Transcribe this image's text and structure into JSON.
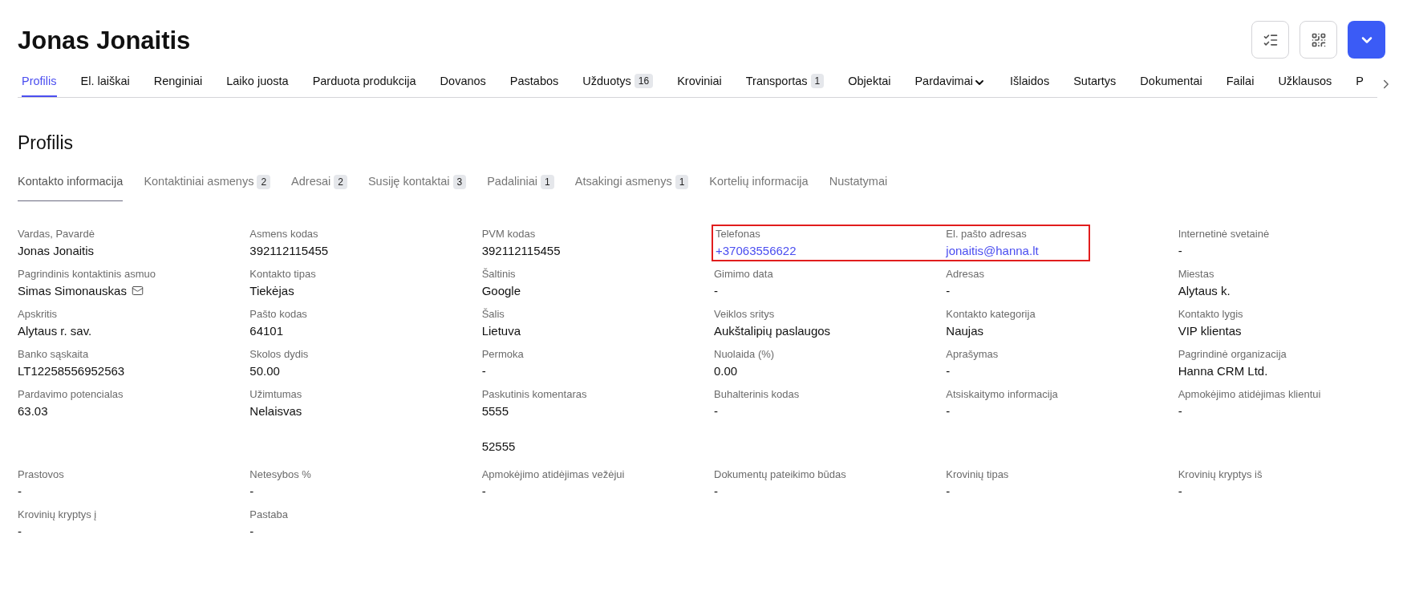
{
  "title": "Jonas Jonaitis",
  "header_buttons": [
    {
      "kind": "checklist"
    },
    {
      "kind": "qr"
    },
    {
      "kind": "dropdown"
    }
  ],
  "tabs": [
    {
      "label": "Profilis",
      "selected": true
    },
    {
      "label": "El. laiškai",
      "selected": false
    },
    {
      "label": "Renginiai",
      "selected": false
    },
    {
      "label": "Laiko juosta",
      "selected": false
    },
    {
      "label": "Parduota produkcija",
      "selected": false
    },
    {
      "label": "Dovanos",
      "selected": false
    },
    {
      "label": "Pastabos",
      "selected": false
    },
    {
      "label": "Užduotys",
      "badge": "16",
      "selected": false
    },
    {
      "label": "Kroviniai",
      "selected": false
    },
    {
      "label": "Transportas",
      "badge": "1",
      "selected": false
    },
    {
      "label": "Objektai",
      "selected": false
    },
    {
      "label": "Pardavimai",
      "dropdown": true,
      "selected": false
    },
    {
      "label": "Išlaidos",
      "selected": false
    },
    {
      "label": "Sutartys",
      "selected": false
    },
    {
      "label": "Dokumentai",
      "selected": false
    },
    {
      "label": "Failai",
      "selected": false
    },
    {
      "label": "Užklausos",
      "selected": false
    },
    {
      "label": "P",
      "selected": false
    }
  ],
  "section_title": "Profilis",
  "subtabs": [
    {
      "label": "Kontakto informacija",
      "selected": true
    },
    {
      "label": "Kontaktiniai asmenys",
      "badge": "2",
      "selected": false
    },
    {
      "label": "Adresai",
      "badge": "2",
      "selected": false
    },
    {
      "label": "Susiję kontaktai",
      "badge": "3",
      "selected": false
    },
    {
      "label": "Padaliniai",
      "badge": "1",
      "selected": false
    },
    {
      "label": "Atsakingi asmenys",
      "badge": "1",
      "selected": false
    },
    {
      "label": "Kortelių informacija",
      "selected": false
    },
    {
      "label": "Nustatymai",
      "selected": false
    }
  ],
  "field_groups": [
    [
      {
        "label": "Vardas, Pavardė",
        "value": "Jonas Jonaitis",
        "kind": "text",
        "highlighted": false
      },
      {
        "label": "Asmens kodas",
        "value": "392112115455",
        "kind": "text",
        "highlighted": false
      },
      {
        "label": "PVM kodas",
        "value": "392112115455",
        "kind": "text",
        "highlighted": false
      },
      {
        "label": "Telefonas",
        "value": "+37063556622",
        "kind": "link",
        "highlighted": true
      },
      {
        "label": "El. pašto adresas",
        "value": "jonaitis@hanna.lt",
        "kind": "link",
        "highlighted": true
      },
      {
        "label": "Internetinė svetainė",
        "value": "-",
        "kind": "text",
        "highlighted": false
      },
      {
        "label": "Pagrindinis kontaktinis asmuo",
        "value": "Simas Simonauskas",
        "kind": "contact",
        "highlighted": false
      },
      {
        "label": "Kontakto tipas",
        "value": "Tiekėjas",
        "kind": "text",
        "highlighted": false
      },
      {
        "label": "Šaltinis",
        "value": "Google",
        "kind": "text",
        "highlighted": false
      },
      {
        "label": "Gimimo data",
        "value": "-",
        "kind": "text",
        "highlighted": false
      },
      {
        "label": "Adresas",
        "value": "-",
        "kind": "text",
        "highlighted": false
      },
      {
        "label": "Miestas",
        "value": "Alytaus k.",
        "kind": "text",
        "highlighted": false
      },
      {
        "label": "Apskritis",
        "value": "Alytaus r. sav.",
        "kind": "text",
        "highlighted": false
      },
      {
        "label": "Pašto kodas",
        "value": "64101",
        "kind": "text",
        "highlighted": false
      },
      {
        "label": "Šalis",
        "value": "Lietuva",
        "kind": "text",
        "highlighted": false
      },
      {
        "label": "Veiklos sritys",
        "value": "Aukštalipių paslaugos",
        "kind": "text",
        "highlighted": false
      },
      {
        "label": "Kontakto kategorija",
        "value": "Naujas",
        "kind": "text",
        "highlighted": false
      },
      {
        "label": "Kontakto lygis",
        "value": "VIP klientas",
        "kind": "text",
        "highlighted": false
      },
      {
        "label": "Banko sąskaita",
        "value": "LT12258556952563",
        "kind": "text",
        "highlighted": false
      },
      {
        "label": "Skolos dydis",
        "value": "50.00",
        "kind": "text",
        "highlighted": false
      },
      {
        "label": "Permoka",
        "value": "-",
        "kind": "text",
        "highlighted": false
      },
      {
        "label": "Nuolaida (%)",
        "value": "0.00",
        "kind": "text",
        "highlighted": false
      },
      {
        "label": "Aprašymas",
        "value": "-",
        "kind": "text",
        "highlighted": false
      },
      {
        "label": "Pagrindinė organizacija",
        "value": "Hanna CRM Ltd.",
        "kind": "text",
        "highlighted": false
      },
      {
        "label": "Pardavimo potencialas",
        "value": "63.03",
        "kind": "text",
        "highlighted": false
      },
      {
        "label": "Užimtumas",
        "value": "Nelaisvas",
        "kind": "text",
        "highlighted": false
      },
      {
        "label": "Paskutinis komentaras",
        "value": "5555\n\n52555",
        "kind": "text",
        "highlighted": false
      },
      {
        "label": "Buhalterinis kodas",
        "value": "-",
        "kind": "text",
        "highlighted": false
      },
      {
        "label": "Atsiskaitymo informacija",
        "value": "-",
        "kind": "text",
        "highlighted": false
      },
      {
        "label": "Apmokėjimo atidėjimas klientui",
        "value": "-",
        "kind": "text",
        "highlighted": false
      }
    ],
    [
      {
        "label": "Prastovos",
        "value": "-",
        "kind": "text",
        "highlighted": false
      },
      {
        "label": "Netesybos %",
        "value": "-",
        "kind": "text",
        "highlighted": false
      },
      {
        "label": "Apmokėjimo atidėjimas vežėjui",
        "value": "-",
        "kind": "text",
        "highlighted": false
      },
      {
        "label": "Dokumentų pateikimo būdas",
        "value": "-",
        "kind": "text",
        "highlighted": false
      },
      {
        "label": "Krovinių tipas",
        "value": "-",
        "kind": "text",
        "highlighted": false
      },
      {
        "label": "Krovinių kryptys iš",
        "value": "-",
        "kind": "text",
        "highlighted": false
      },
      {
        "label": "Krovinių kryptys į",
        "value": "-",
        "kind": "text",
        "highlighted": false
      },
      {
        "label": "Pastaba",
        "value": "-",
        "kind": "text",
        "highlighted": false
      }
    ]
  ]
}
